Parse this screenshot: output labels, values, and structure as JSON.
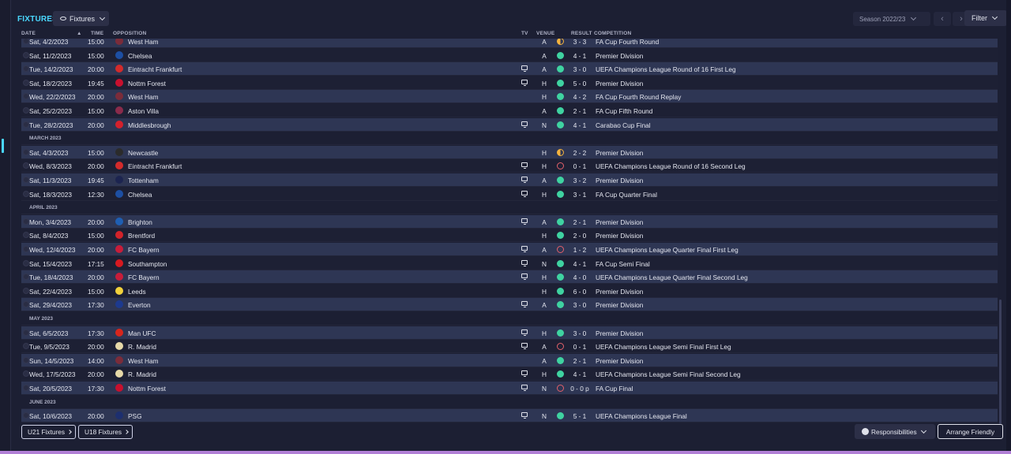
{
  "header": {
    "title": "FIXTURES",
    "view_dropdown": "Fixtures",
    "season": "Season 2022/23",
    "prev": "‹",
    "next": "›",
    "filter": "Filter"
  },
  "columns": {
    "date": "DATE",
    "time": "TIME",
    "opposition": "OPPOSITION",
    "tv": "TV",
    "venue": "VENUE",
    "result": "RESULT",
    "competition": "COMPETITION"
  },
  "colors": {
    "accent": "#4ad7ff",
    "win": "#3fd3a1",
    "loss": "#e2606a",
    "draw": "#f4b33e"
  },
  "rows": [
    {
      "type": "match",
      "date": "Sat, 4/2/2023",
      "time": "15:00",
      "opp": "West Ham",
      "crest": "#7b2c3a",
      "tv": false,
      "venue": "A",
      "outcome": "draw",
      "result": "3 - 3",
      "comp": "FA Cup Fourth Round"
    },
    {
      "type": "match",
      "date": "Sat, 11/2/2023",
      "time": "15:00",
      "opp": "Chelsea",
      "crest": "#1d4fa3",
      "tv": false,
      "venue": "A",
      "outcome": "win",
      "result": "4 - 1",
      "comp": "Premier Division"
    },
    {
      "type": "match",
      "date": "Tue, 14/2/2023",
      "time": "20:00",
      "opp": "Eintracht Frankfurt",
      "crest": "#d32b2b",
      "tv": true,
      "venue": "A",
      "outcome": "win",
      "result": "3 - 0",
      "comp": "UEFA Champions League Round of 16 First Leg"
    },
    {
      "type": "match",
      "date": "Sat, 18/2/2023",
      "time": "19:45",
      "opp": "Nottm Forest",
      "crest": "#c8102e",
      "tv": true,
      "venue": "H",
      "outcome": "win",
      "result": "5 - 0",
      "comp": "Premier Division"
    },
    {
      "type": "match",
      "date": "Wed, 22/2/2023",
      "time": "20:00",
      "opp": "West Ham",
      "crest": "#7b2c3a",
      "tv": false,
      "venue": "H",
      "outcome": "win",
      "result": "4 - 2",
      "comp": "FA Cup Fourth Round Replay"
    },
    {
      "type": "match",
      "date": "Sat, 25/2/2023",
      "time": "15:00",
      "opp": "Aston Villa",
      "crest": "#8a2b4b",
      "tv": false,
      "venue": "A",
      "outcome": "win",
      "result": "2 - 1",
      "comp": "FA Cup Fifth Round"
    },
    {
      "type": "match",
      "date": "Tue, 28/2/2023",
      "time": "20:00",
      "opp": "Middlesbrough",
      "crest": "#d4212c",
      "tv": true,
      "venue": "N",
      "outcome": "win",
      "result": "4 - 1",
      "comp": "Carabao Cup Final"
    },
    {
      "type": "month",
      "label": "MARCH 2023"
    },
    {
      "type": "match",
      "date": "Sat, 4/3/2023",
      "time": "15:00",
      "opp": "Newcastle",
      "crest": "#2b2b2b",
      "tv": false,
      "venue": "H",
      "outcome": "draw",
      "result": "2 - 2",
      "comp": "Premier Division"
    },
    {
      "type": "match",
      "date": "Wed, 8/3/2023",
      "time": "20:00",
      "opp": "Eintracht Frankfurt",
      "crest": "#d32b2b",
      "tv": true,
      "venue": "H",
      "outcome": "loss",
      "result": "0 - 1",
      "comp": "UEFA Champions League Round of 16 Second Leg"
    },
    {
      "type": "match",
      "date": "Sat, 11/3/2023",
      "time": "19:45",
      "opp": "Tottenham",
      "crest": "#1c2450",
      "tv": true,
      "venue": "A",
      "outcome": "win",
      "result": "3 - 2",
      "comp": "Premier Division"
    },
    {
      "type": "match",
      "date": "Sat, 18/3/2023",
      "time": "12:30",
      "opp": "Chelsea",
      "crest": "#1d4fa3",
      "tv": true,
      "venue": "H",
      "outcome": "win",
      "result": "3 - 1",
      "comp": "FA Cup Quarter Final"
    },
    {
      "type": "month",
      "label": "APRIL 2023"
    },
    {
      "type": "match",
      "date": "Mon, 3/4/2023",
      "time": "20:00",
      "opp": "Brighton",
      "crest": "#1f5fb3",
      "tv": true,
      "venue": "A",
      "outcome": "win",
      "result": "2 - 1",
      "comp": "Premier Division"
    },
    {
      "type": "match",
      "date": "Sat, 8/4/2023",
      "time": "15:00",
      "opp": "Brentford",
      "crest": "#d2232a",
      "tv": false,
      "venue": "H",
      "outcome": "win",
      "result": "2 - 0",
      "comp": "Premier Division"
    },
    {
      "type": "match",
      "date": "Wed, 12/4/2023",
      "time": "20:00",
      "opp": "FC Bayern",
      "crest": "#c81d3a",
      "tv": true,
      "venue": "A",
      "outcome": "loss",
      "result": "1 - 2",
      "comp": "UEFA Champions League Quarter Final First Leg"
    },
    {
      "type": "match",
      "date": "Sat, 15/4/2023",
      "time": "17:15",
      "opp": "Southampton",
      "crest": "#d71920",
      "tv": true,
      "venue": "N",
      "outcome": "win",
      "result": "4 - 1",
      "comp": "FA Cup Semi Final"
    },
    {
      "type": "match",
      "date": "Tue, 18/4/2023",
      "time": "20:00",
      "opp": "FC Bayern",
      "crest": "#c81d3a",
      "tv": true,
      "venue": "H",
      "outcome": "win",
      "result": "4 - 0",
      "comp": "UEFA Champions League Quarter Final Second Leg"
    },
    {
      "type": "match",
      "date": "Sat, 22/4/2023",
      "time": "15:00",
      "opp": "Leeds",
      "crest": "#f2d23c",
      "tv": false,
      "venue": "H",
      "outcome": "win",
      "result": "6 - 0",
      "comp": "Premier Division"
    },
    {
      "type": "match",
      "date": "Sat, 29/4/2023",
      "time": "17:30",
      "opp": "Everton",
      "crest": "#1d3a8f",
      "tv": true,
      "venue": "A",
      "outcome": "win",
      "result": "3 - 0",
      "comp": "Premier Division"
    },
    {
      "type": "month",
      "label": "MAY 2023"
    },
    {
      "type": "match",
      "date": "Sat, 6/5/2023",
      "time": "17:30",
      "opp": "Man UFC",
      "crest": "#d8261c",
      "tv": true,
      "venue": "H",
      "outcome": "win",
      "result": "3 - 0",
      "comp": "Premier Division"
    },
    {
      "type": "match",
      "date": "Tue, 9/5/2023",
      "time": "20:00",
      "opp": "R. Madrid",
      "crest": "#e6d9a8",
      "tv": true,
      "venue": "A",
      "outcome": "loss",
      "result": "0 - 1",
      "comp": "UEFA Champions League Semi Final First Leg"
    },
    {
      "type": "match",
      "date": "Sun, 14/5/2023",
      "time": "14:00",
      "opp": "West Ham",
      "crest": "#7b2c3a",
      "tv": false,
      "venue": "A",
      "outcome": "win",
      "result": "2 - 1",
      "comp": "Premier Division"
    },
    {
      "type": "match",
      "date": "Wed, 17/5/2023",
      "time": "20:00",
      "opp": "R. Madrid",
      "crest": "#e6d9a8",
      "tv": true,
      "venue": "H",
      "outcome": "win",
      "result": "4 - 1",
      "comp": "UEFA Champions League Semi Final Second Leg"
    },
    {
      "type": "match",
      "date": "Sat, 20/5/2023",
      "time": "17:30",
      "opp": "Nottm Forest",
      "crest": "#c8102e",
      "tv": true,
      "venue": "N",
      "outcome": "loss",
      "result": "0 - 0 p",
      "comp": "FA Cup Final"
    },
    {
      "type": "month",
      "label": "JUNE 2023"
    },
    {
      "type": "match",
      "date": "Sat, 10/6/2023",
      "time": "20:00",
      "opp": "PSG",
      "crest": "#1d2f6f",
      "tv": true,
      "venue": "N",
      "outcome": "win",
      "result": "5 - 1",
      "comp": "UEFA Champions League Final"
    }
  ],
  "footer": {
    "u21": "U21 Fixtures",
    "u18": "U18 Fixtures",
    "responsibilities": "Responsibilities",
    "arrange": "Arrange Friendly"
  }
}
